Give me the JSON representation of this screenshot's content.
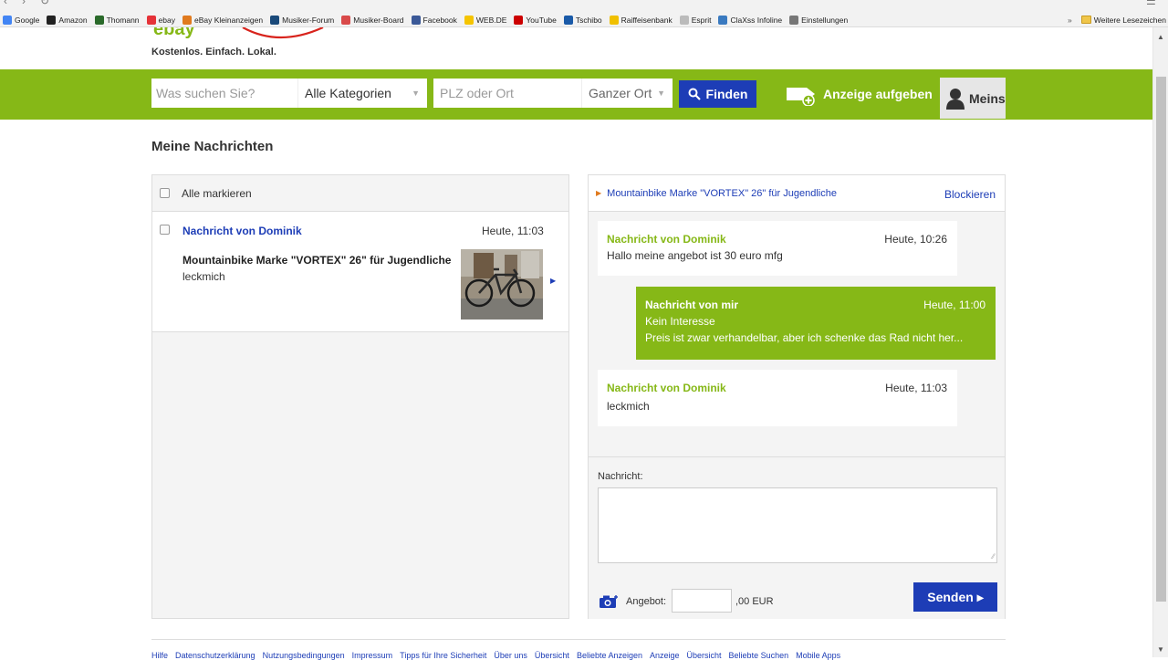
{
  "browser": {
    "bookmarks": [
      {
        "label": "Google",
        "color": "#4285f4"
      },
      {
        "label": "Amazon",
        "color": "#222222"
      },
      {
        "label": "Thomann",
        "color": "#2a6a2a"
      },
      {
        "label": "ebay",
        "color": "#e53238"
      },
      {
        "label": "eBay Kleinanzeigen",
        "color": "#e07a1e"
      },
      {
        "label": "Musiker-Forum",
        "color": "#1a4a7a"
      },
      {
        "label": "Musiker-Board",
        "color": "#d94a4a"
      },
      {
        "label": "Facebook",
        "color": "#3b5998"
      },
      {
        "label": "WEB.DE",
        "color": "#f5c400"
      },
      {
        "label": "YouTube",
        "color": "#cc0000"
      },
      {
        "label": "Tschibo",
        "color": "#1a5aa8"
      },
      {
        "label": "Raiffeisenbank",
        "color": "#f0c000"
      },
      {
        "label": "Esprit",
        "color": "#bbbbbb"
      },
      {
        "label": "ClaXss Infoline",
        "color": "#3a7ac0"
      },
      {
        "label": "Einstellungen",
        "color": "#777777"
      }
    ],
    "more_chevron": "»",
    "other_bookmarks": "Weitere Lesezeichen"
  },
  "header": {
    "tagline": "Kostenlos. Einfach. Lokal.",
    "search_placeholder": "Was suchen Sie?",
    "category": "Alle Kategorien",
    "location_placeholder": "PLZ oder Ort",
    "radius": "Ganzer Ort",
    "find_label": "Finden",
    "post_ad_label": "Anzeige aufgeben",
    "account_label": "Meins"
  },
  "page": {
    "title": "Meine Nachrichten"
  },
  "conversations": {
    "select_all_label": "Alle markieren",
    "items": [
      {
        "sender": "Nachricht von Dominik",
        "time": "Heute, 11:03",
        "subject": "Mountainbike Marke \"VORTEX\" 26\" für Jugendliche",
        "preview": "leckmich"
      }
    ]
  },
  "thread": {
    "ad_title": "Mountainbike Marke \"VORTEX\" 26\" für Jugendliche",
    "block_label": "Blockieren",
    "messages": [
      {
        "sender": "Nachricht von Dominik",
        "time": "Heute, 10:26",
        "lines": [
          "Hallo meine angebot ist 30 euro mfg"
        ]
      },
      {
        "sender": "Nachricht von mir",
        "time": "Heute, 11:00",
        "lines": [
          "Kein Interesse",
          "Preis ist zwar verhandelbar, aber ich schenke das Rad nicht her..."
        ]
      },
      {
        "sender": "Nachricht von Dominik",
        "time": "Heute, 11:03",
        "lines": [
          "leckmich"
        ]
      }
    ]
  },
  "compose": {
    "label": "Nachricht:",
    "offer_label": "Angebot:",
    "offer_suffix": ",00 EUR",
    "send_label": "Senden ▸"
  },
  "footer": {
    "links": [
      "Hilfe",
      "Datenschutzerklärung",
      "Nutzungsbedingungen",
      "Impressum",
      "Tipps für Ihre Sicherheit",
      "Über uns",
      "Übersicht",
      "Beliebte Anzeigen",
      "Anzeige",
      "Übersicht",
      "Beliebte Suchen",
      "Mobile Apps"
    ]
  },
  "colors": {
    "brand_green": "#86b817",
    "brand_blue": "#1d3db6",
    "accent_orange": "#e07a1e"
  }
}
